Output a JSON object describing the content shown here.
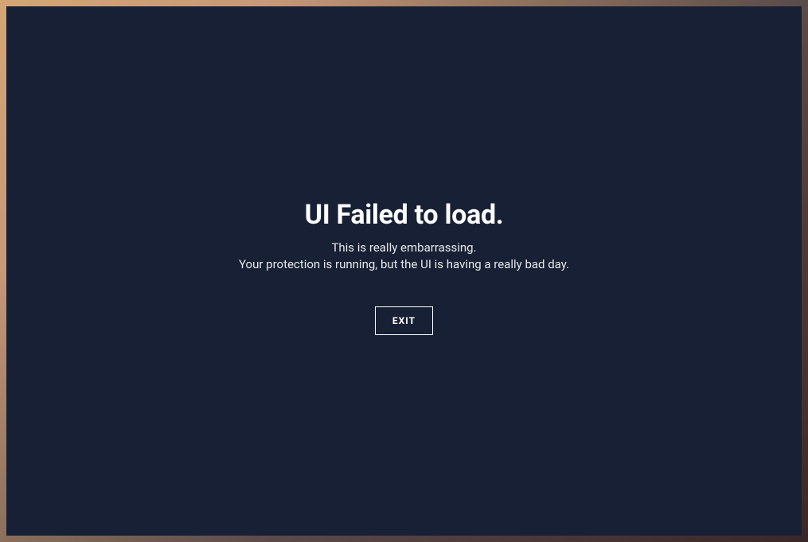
{
  "error": {
    "heading": "UI Failed to load.",
    "message_line_1": "This is really embarrassing.",
    "message_line_2": "Your protection is running, but the UI is having a really bad day.",
    "exit_button_label": "EXIT"
  }
}
